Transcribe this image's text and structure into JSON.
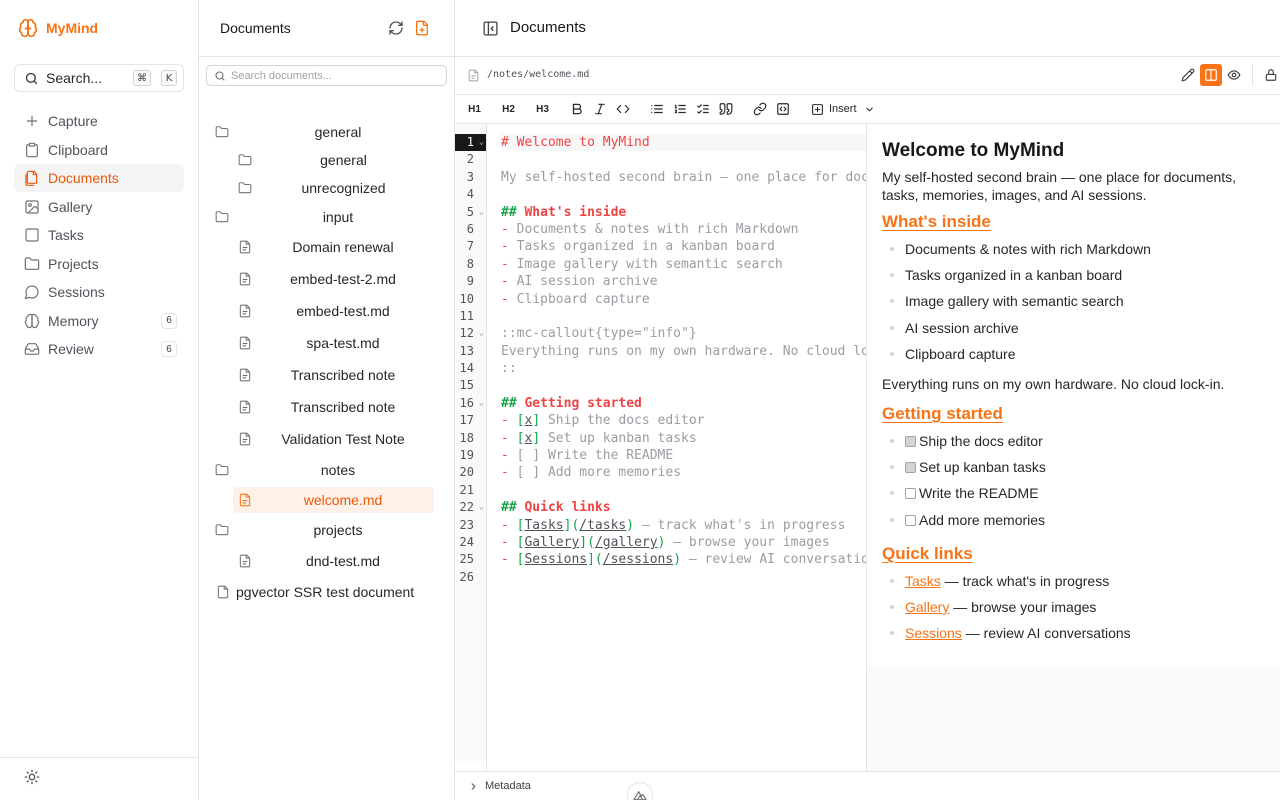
{
  "colors": {
    "accent": "#f97316",
    "border": "#e4e4e7",
    "heading_code": "#ef4444",
    "heading_marker": "#16a34a"
  },
  "app": {
    "name": "MyMind"
  },
  "sidebar": {
    "search_label": "Search...",
    "search_keys": [
      "⌘",
      "K"
    ],
    "items": [
      {
        "label": "Capture",
        "icon": "plus-icon"
      },
      {
        "label": "Clipboard",
        "icon": "clipboard-icon"
      },
      {
        "label": "Documents",
        "icon": "documents-icon",
        "active": true
      },
      {
        "label": "Gallery",
        "icon": "image-icon"
      },
      {
        "label": "Tasks",
        "icon": "checkbox-icon"
      },
      {
        "label": "Projects",
        "icon": "folder-icon"
      },
      {
        "label": "Sessions",
        "icon": "chat-icon"
      },
      {
        "label": "Memory",
        "icon": "brain-icon",
        "count": "6"
      },
      {
        "label": "Review",
        "icon": "inbox-icon",
        "count": "6"
      }
    ]
  },
  "docs": {
    "title": "Documents",
    "search_placeholder": "Search documents...",
    "tree": [
      {
        "label": "general",
        "type": "folder",
        "depth": 0
      },
      {
        "label": "general",
        "type": "folder",
        "depth": 1
      },
      {
        "label": "unrecognized",
        "type": "folder",
        "depth": 1
      },
      {
        "label": "input",
        "type": "folder",
        "depth": 0
      },
      {
        "label": "Domain renewal",
        "type": "file",
        "depth": 1
      },
      {
        "label": "embed-test-2.md",
        "type": "file",
        "depth": 1
      },
      {
        "label": "embed-test.md",
        "type": "file",
        "depth": 1
      },
      {
        "label": "spa-test.md",
        "type": "file",
        "depth": 1
      },
      {
        "label": "Transcribed note",
        "type": "file",
        "depth": 1
      },
      {
        "label": "Transcribed note",
        "type": "file",
        "depth": 1
      },
      {
        "label": "Validation Test Note",
        "type": "file",
        "depth": 1
      },
      {
        "label": "notes",
        "type": "folder",
        "depth": 0
      },
      {
        "label": "welcome.md",
        "type": "file",
        "depth": 1,
        "selected": true
      },
      {
        "label": "projects",
        "type": "folder",
        "depth": 0
      },
      {
        "label": "dnd-test.md",
        "type": "file",
        "depth": 1
      },
      {
        "label": "pgvector SSR test document",
        "type": "file",
        "depth": 0,
        "root": true
      }
    ]
  },
  "main": {
    "title": "Documents",
    "path": "/notes/welcome.md",
    "view_mode": "split",
    "toolbar": {
      "h1": "H1",
      "h2": "H2",
      "h3": "H3",
      "insert": "Insert"
    },
    "editor": {
      "current_line": 1,
      "fold_lines": [
        1,
        5,
        12,
        16,
        22
      ],
      "lines": [
        [
          [
            "h",
            "# Welcome to MyMind"
          ]
        ],
        [],
        [
          [
            "t",
            "My self-hosted second brain — one place for documents, tasks, memories, images, and AI sessions."
          ]
        ],
        [],
        [
          [
            "hm",
            "## "
          ],
          [
            "ht",
            "What's inside"
          ]
        ],
        [
          [
            "list",
            "-"
          ],
          [
            "t",
            " Documents & notes with rich Markdown"
          ]
        ],
        [
          [
            "list",
            "-"
          ],
          [
            "t",
            " Tasks organized in a kanban board"
          ]
        ],
        [
          [
            "list",
            "-"
          ],
          [
            "t",
            " Image gallery with semantic search"
          ]
        ],
        [
          [
            "list",
            "-"
          ],
          [
            "t",
            " AI session archive"
          ]
        ],
        [
          [
            "list",
            "-"
          ],
          [
            "t",
            " Clipboard capture"
          ]
        ],
        [],
        [
          [
            "t",
            "::mc-callout{type=\"info\"}"
          ]
        ],
        [
          [
            "t",
            "Everything runs on my own hardware. No cloud lock-in."
          ]
        ],
        [
          [
            "t",
            "::"
          ]
        ],
        [],
        [
          [
            "hm",
            "## "
          ],
          [
            "ht",
            "Getting started"
          ]
        ],
        [
          [
            "list",
            "-"
          ],
          [
            "t",
            " "
          ],
          [
            "br",
            "["
          ],
          [
            "x",
            "x"
          ],
          [
            "br",
            "]"
          ],
          [
            "t",
            " Ship the docs editor"
          ]
        ],
        [
          [
            "list",
            "-"
          ],
          [
            "t",
            " "
          ],
          [
            "br",
            "["
          ],
          [
            "x",
            "x"
          ],
          [
            "br",
            "]"
          ],
          [
            "t",
            " Set up kanban tasks"
          ]
        ],
        [
          [
            "list",
            "-"
          ],
          [
            "t",
            " [ ] Write the README"
          ]
        ],
        [
          [
            "list",
            "-"
          ],
          [
            "t",
            " [ ] Add more memories"
          ]
        ],
        [],
        [
          [
            "hm",
            "## "
          ],
          [
            "ht",
            "Quick links"
          ]
        ],
        [
          [
            "list",
            "-"
          ],
          [
            "t",
            " "
          ],
          [
            "br",
            "["
          ],
          [
            "link",
            "Tasks"
          ],
          [
            "br",
            "]("
          ],
          [
            "url",
            "/tasks"
          ],
          [
            "br",
            ")"
          ],
          [
            "t",
            " — track what's in progress"
          ]
        ],
        [
          [
            "list",
            "-"
          ],
          [
            "t",
            " "
          ],
          [
            "br",
            "["
          ],
          [
            "link",
            "Gallery"
          ],
          [
            "br",
            "]("
          ],
          [
            "url",
            "/gallery"
          ],
          [
            "br",
            ")"
          ],
          [
            "t",
            " — browse your images"
          ]
        ],
        [
          [
            "list",
            "-"
          ],
          [
            "t",
            " "
          ],
          [
            "br",
            "["
          ],
          [
            "link",
            "Sessions"
          ],
          [
            "br",
            "]("
          ],
          [
            "url",
            "/sessions"
          ],
          [
            "br",
            ")"
          ],
          [
            "t",
            " — review AI conversations"
          ]
        ],
        []
      ]
    },
    "preview": {
      "h1": "Welcome to MyMind",
      "intro": "My self-hosted second brain — one place for documents, tasks, memories, images, and AI sessions.",
      "section_inside": "What's inside",
      "inside_items": [
        "Documents & notes with rich Markdown",
        "Tasks organized in a kanban board",
        "Image gallery with semantic search",
        "AI session archive",
        "Clipboard capture"
      ],
      "callout": "Everything runs on my own hardware. No cloud lock-in.",
      "section_start": "Getting started",
      "start_items": [
        {
          "label": "Ship the docs editor",
          "checked": true
        },
        {
          "label": "Set up kanban tasks",
          "checked": true
        },
        {
          "label": "Write the README",
          "checked": false
        },
        {
          "label": "Add more memories",
          "checked": false
        }
      ],
      "section_links": "Quick links",
      "links": [
        {
          "label": "Tasks",
          "rest": " — track what's in progress"
        },
        {
          "label": "Gallery",
          "rest": " — browse your images"
        },
        {
          "label": "Sessions",
          "rest": " — review AI conversations"
        }
      ]
    },
    "metadata_label": "Metadata"
  }
}
